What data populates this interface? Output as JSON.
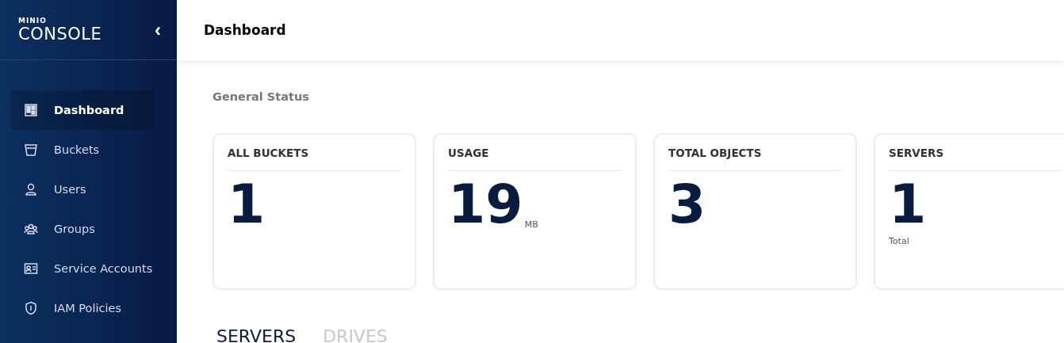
{
  "sidebar": {
    "logo_top": "MINIO",
    "logo": "CONSOLE",
    "collapse": "‹",
    "items": [
      {
        "label": "Dashboard",
        "selected": true
      },
      {
        "label": "Buckets",
        "selected": false
      },
      {
        "label": "Users",
        "selected": false
      },
      {
        "label": "Groups",
        "selected": false
      },
      {
        "label": "Service Accounts",
        "selected": false
      },
      {
        "label": "IAM Policies",
        "selected": false
      }
    ]
  },
  "header": {
    "title": "Dashboard"
  },
  "section_title": "General Status",
  "cards": [
    {
      "title": "ALL BUCKETS",
      "value": "1"
    },
    {
      "title": "USAGE",
      "value": "19",
      "unit": "MB"
    },
    {
      "title": "TOTAL OBJECTS",
      "value": "3"
    },
    {
      "title": "SERVERS",
      "value": "1",
      "note": "Total"
    }
  ],
  "tabs": [
    {
      "label": "SERVERS",
      "selected": true
    },
    {
      "label": "DRIVES",
      "selected": false
    }
  ]
}
